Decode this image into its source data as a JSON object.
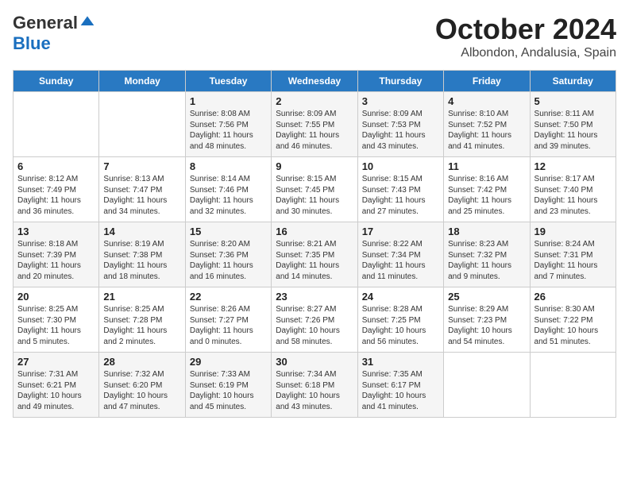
{
  "logo": {
    "general": "General",
    "blue": "Blue"
  },
  "header": {
    "month": "October 2024",
    "location": "Albondon, Andalusia, Spain"
  },
  "weekdays": [
    "Sunday",
    "Monday",
    "Tuesday",
    "Wednesday",
    "Thursday",
    "Friday",
    "Saturday"
  ],
  "weeks": [
    [
      {
        "day": "",
        "sunrise": "",
        "sunset": "",
        "daylight": ""
      },
      {
        "day": "",
        "sunrise": "",
        "sunset": "",
        "daylight": ""
      },
      {
        "day": "1",
        "sunrise": "Sunrise: 8:08 AM",
        "sunset": "Sunset: 7:56 PM",
        "daylight": "Daylight: 11 hours and 48 minutes."
      },
      {
        "day": "2",
        "sunrise": "Sunrise: 8:09 AM",
        "sunset": "Sunset: 7:55 PM",
        "daylight": "Daylight: 11 hours and 46 minutes."
      },
      {
        "day": "3",
        "sunrise": "Sunrise: 8:09 AM",
        "sunset": "Sunset: 7:53 PM",
        "daylight": "Daylight: 11 hours and 43 minutes."
      },
      {
        "day": "4",
        "sunrise": "Sunrise: 8:10 AM",
        "sunset": "Sunset: 7:52 PM",
        "daylight": "Daylight: 11 hours and 41 minutes."
      },
      {
        "day": "5",
        "sunrise": "Sunrise: 8:11 AM",
        "sunset": "Sunset: 7:50 PM",
        "daylight": "Daylight: 11 hours and 39 minutes."
      }
    ],
    [
      {
        "day": "6",
        "sunrise": "Sunrise: 8:12 AM",
        "sunset": "Sunset: 7:49 PM",
        "daylight": "Daylight: 11 hours and 36 minutes."
      },
      {
        "day": "7",
        "sunrise": "Sunrise: 8:13 AM",
        "sunset": "Sunset: 7:47 PM",
        "daylight": "Daylight: 11 hours and 34 minutes."
      },
      {
        "day": "8",
        "sunrise": "Sunrise: 8:14 AM",
        "sunset": "Sunset: 7:46 PM",
        "daylight": "Daylight: 11 hours and 32 minutes."
      },
      {
        "day": "9",
        "sunrise": "Sunrise: 8:15 AM",
        "sunset": "Sunset: 7:45 PM",
        "daylight": "Daylight: 11 hours and 30 minutes."
      },
      {
        "day": "10",
        "sunrise": "Sunrise: 8:15 AM",
        "sunset": "Sunset: 7:43 PM",
        "daylight": "Daylight: 11 hours and 27 minutes."
      },
      {
        "day": "11",
        "sunrise": "Sunrise: 8:16 AM",
        "sunset": "Sunset: 7:42 PM",
        "daylight": "Daylight: 11 hours and 25 minutes."
      },
      {
        "day": "12",
        "sunrise": "Sunrise: 8:17 AM",
        "sunset": "Sunset: 7:40 PM",
        "daylight": "Daylight: 11 hours and 23 minutes."
      }
    ],
    [
      {
        "day": "13",
        "sunrise": "Sunrise: 8:18 AM",
        "sunset": "Sunset: 7:39 PM",
        "daylight": "Daylight: 11 hours and 20 minutes."
      },
      {
        "day": "14",
        "sunrise": "Sunrise: 8:19 AM",
        "sunset": "Sunset: 7:38 PM",
        "daylight": "Daylight: 11 hours and 18 minutes."
      },
      {
        "day": "15",
        "sunrise": "Sunrise: 8:20 AM",
        "sunset": "Sunset: 7:36 PM",
        "daylight": "Daylight: 11 hours and 16 minutes."
      },
      {
        "day": "16",
        "sunrise": "Sunrise: 8:21 AM",
        "sunset": "Sunset: 7:35 PM",
        "daylight": "Daylight: 11 hours and 14 minutes."
      },
      {
        "day": "17",
        "sunrise": "Sunrise: 8:22 AM",
        "sunset": "Sunset: 7:34 PM",
        "daylight": "Daylight: 11 hours and 11 minutes."
      },
      {
        "day": "18",
        "sunrise": "Sunrise: 8:23 AM",
        "sunset": "Sunset: 7:32 PM",
        "daylight": "Daylight: 11 hours and 9 minutes."
      },
      {
        "day": "19",
        "sunrise": "Sunrise: 8:24 AM",
        "sunset": "Sunset: 7:31 PM",
        "daylight": "Daylight: 11 hours and 7 minutes."
      }
    ],
    [
      {
        "day": "20",
        "sunrise": "Sunrise: 8:25 AM",
        "sunset": "Sunset: 7:30 PM",
        "daylight": "Daylight: 11 hours and 5 minutes."
      },
      {
        "day": "21",
        "sunrise": "Sunrise: 8:25 AM",
        "sunset": "Sunset: 7:28 PM",
        "daylight": "Daylight: 11 hours and 2 minutes."
      },
      {
        "day": "22",
        "sunrise": "Sunrise: 8:26 AM",
        "sunset": "Sunset: 7:27 PM",
        "daylight": "Daylight: 11 hours and 0 minutes."
      },
      {
        "day": "23",
        "sunrise": "Sunrise: 8:27 AM",
        "sunset": "Sunset: 7:26 PM",
        "daylight": "Daylight: 10 hours and 58 minutes."
      },
      {
        "day": "24",
        "sunrise": "Sunrise: 8:28 AM",
        "sunset": "Sunset: 7:25 PM",
        "daylight": "Daylight: 10 hours and 56 minutes."
      },
      {
        "day": "25",
        "sunrise": "Sunrise: 8:29 AM",
        "sunset": "Sunset: 7:23 PM",
        "daylight": "Daylight: 10 hours and 54 minutes."
      },
      {
        "day": "26",
        "sunrise": "Sunrise: 8:30 AM",
        "sunset": "Sunset: 7:22 PM",
        "daylight": "Daylight: 10 hours and 51 minutes."
      }
    ],
    [
      {
        "day": "27",
        "sunrise": "Sunrise: 7:31 AM",
        "sunset": "Sunset: 6:21 PM",
        "daylight": "Daylight: 10 hours and 49 minutes."
      },
      {
        "day": "28",
        "sunrise": "Sunrise: 7:32 AM",
        "sunset": "Sunset: 6:20 PM",
        "daylight": "Daylight: 10 hours and 47 minutes."
      },
      {
        "day": "29",
        "sunrise": "Sunrise: 7:33 AM",
        "sunset": "Sunset: 6:19 PM",
        "daylight": "Daylight: 10 hours and 45 minutes."
      },
      {
        "day": "30",
        "sunrise": "Sunrise: 7:34 AM",
        "sunset": "Sunset: 6:18 PM",
        "daylight": "Daylight: 10 hours and 43 minutes."
      },
      {
        "day": "31",
        "sunrise": "Sunrise: 7:35 AM",
        "sunset": "Sunset: 6:17 PM",
        "daylight": "Daylight: 10 hours and 41 minutes."
      },
      {
        "day": "",
        "sunrise": "",
        "sunset": "",
        "daylight": ""
      },
      {
        "day": "",
        "sunrise": "",
        "sunset": "",
        "daylight": ""
      }
    ]
  ]
}
